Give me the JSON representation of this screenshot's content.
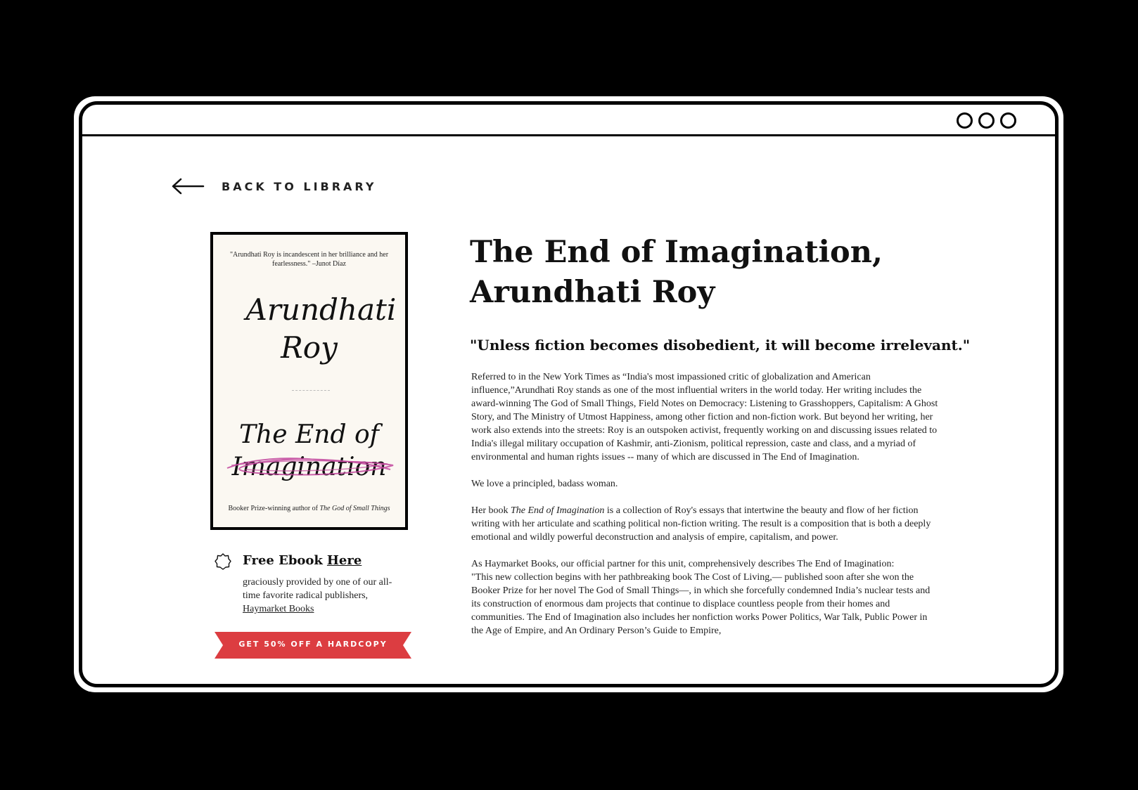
{
  "window": {
    "controls": [
      "circle-button",
      "circle-button",
      "circle-button"
    ]
  },
  "nav": {
    "back_label": "BACK TO LIBRARY"
  },
  "cover": {
    "blurb": "\"Arundhati Roy is incandescent in her brilliance and her fearlessness.\" –Junot Díaz",
    "author": "Arundhati Roy",
    "title_line1": "The End of",
    "title_line2": "Imagination",
    "footer_prefix": "Booker Prize-winning author of ",
    "footer_book": "The God of Small Things"
  },
  "ebook": {
    "title": "Free Ebook",
    "link_label": "Here",
    "note": "graciously provided by one of our all-time favorite radical publishers,",
    "publisher_link": "Haymarket Books"
  },
  "cta": {
    "label": "GET 50% OFF A HARDCOPY",
    "color": "#dc3d41"
  },
  "book": {
    "title_line1": "The End of Imagination,",
    "title_line2": "Arundhati Roy",
    "quote": "\"Unless fiction becomes disobedient, it will become irrelevant.\"",
    "para1": "Referred to in the New York Times as “India's most impassioned critic of globalization and American influence,”Arundhati Roy stands as one of the most influential writers in the world today. Her writing includes the award-winning The God of Small Things, Field Notes on Democracy: Listening to Grasshoppers, Capitalism: A Ghost Story, and The Ministry of Utmost Happiness, among other fiction and non-fiction work. But beyond her writing, her work also extends into the streets: Roy is an outspoken activist, frequently working on and discussing issues related to India's illegal military occupation of Kashmir, anti-Zionism, political repression, caste and class, and a myriad of environmental and human rights issues -- many of which are discussed in The End of Imagination.",
    "para2": "We love a principled, badass woman.",
    "para3_prefix": "Her book ",
    "para3_italic": "The End of Imagination",
    "para3_rest": " is a collection of Roy's essays that intertwine the beauty and flow of her fiction writing with her articulate and scathing political non-fiction writing. The result is a composition that is both a deeply emotional and wildly powerful deconstruction and analysis of empire, capitalism, and power.",
    "para4": "As Haymarket Books, our official partner for this unit, comprehensively describes The End of Imagination:",
    "para5": "\"This new collection begins with her pathbreaking book The Cost of Living,— published soon after she won the Booker Prize for her novel The God of Small Things—, in which she forcefully condemned India’s nuclear tests and its construction of enormous dam projects that continue to displace countless people from their homes and communities. The End of Imagination also includes her nonfiction works Power Politics, War Talk, Public Power in the Age of Empire, and An Ordinary Person’s Guide to Empire,"
  }
}
